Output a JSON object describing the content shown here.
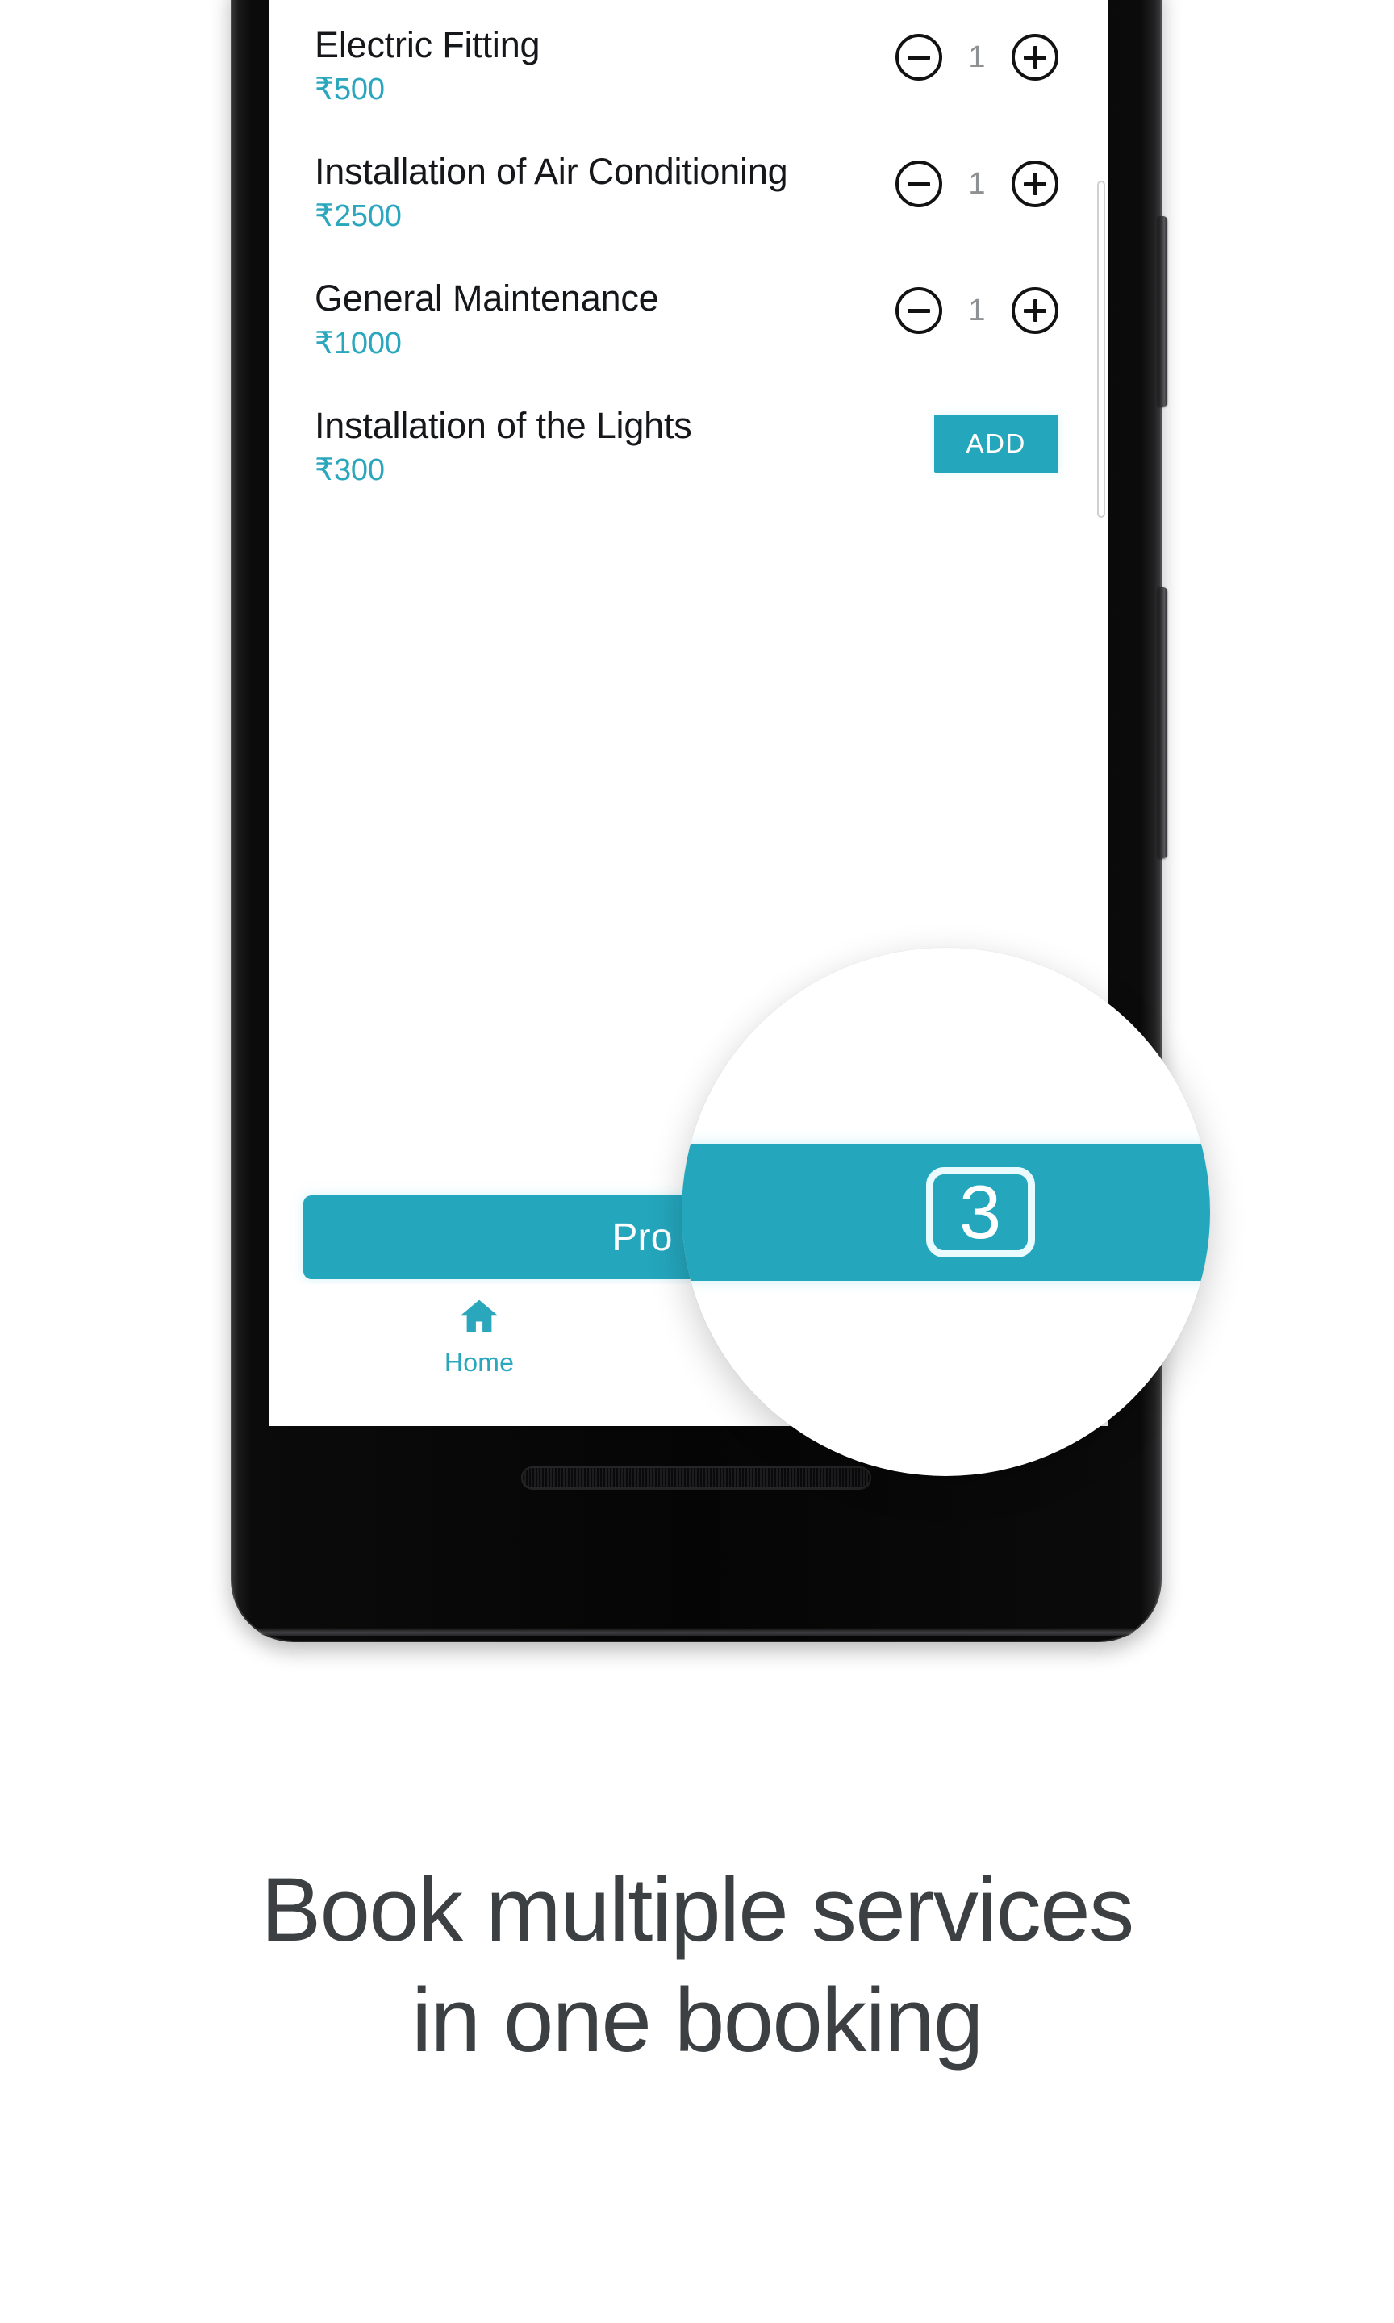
{
  "app": {
    "accent_color": "#24a6bd",
    "services": [
      {
        "name": "Electric Fitting",
        "price": "₹500",
        "control": "stepper",
        "quantity": "1",
        "decrement_icon": "minus-circle-icon",
        "increment_icon": "plus-circle-icon"
      },
      {
        "name": "Installation of Air Conditioning",
        "price": "₹2500",
        "control": "stepper",
        "quantity": "1",
        "decrement_icon": "minus-circle-icon",
        "increment_icon": "plus-circle-icon"
      },
      {
        "name": "General Maintenance",
        "price": "₹1000",
        "control": "stepper",
        "quantity": "1",
        "decrement_icon": "minus-circle-icon",
        "increment_icon": "plus-circle-icon"
      },
      {
        "name": "Installation of the Lights",
        "price": "₹300",
        "control": "add",
        "add_label": "ADD"
      }
    ],
    "proceed": {
      "label": "Pro",
      "count": "3"
    },
    "bottom_nav": [
      {
        "label": "Home",
        "icon": "home-icon",
        "active": true
      },
      {
        "label": "",
        "icon": "list-icon",
        "active": false
      }
    ]
  },
  "magnifier": {
    "magnified_value": "3",
    "icon": "magnifier-loupe"
  },
  "caption": {
    "line1": "Book multiple services",
    "line2": "in one booking"
  }
}
